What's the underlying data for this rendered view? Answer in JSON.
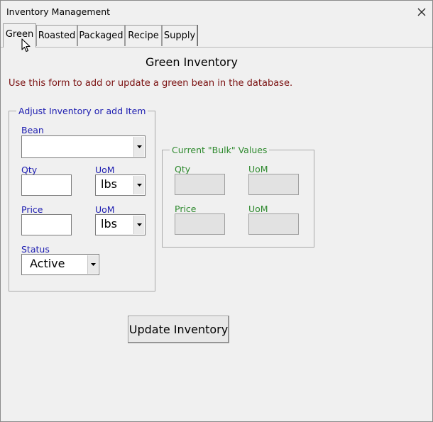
{
  "window": {
    "title": "Inventory Management"
  },
  "tabs": [
    {
      "label": "Green",
      "active": true
    },
    {
      "label": "Roasted",
      "active": false
    },
    {
      "label": "Packaged",
      "active": false
    },
    {
      "label": "Recipe",
      "active": false
    },
    {
      "label": "Supply",
      "active": false
    }
  ],
  "form": {
    "heading": "Green Inventory",
    "instructions": "Use this form to add or update a green bean in the database.",
    "adjust_group": {
      "legend": "Adjust Inventory or add Item",
      "bean_label": "Bean",
      "bean_value": "",
      "qty_label": "Qty",
      "qty_value": "",
      "qty_uom_label": "UoM",
      "qty_uom_value": "lbs",
      "price_label": "Price",
      "price_value": "",
      "price_uom_label": "UoM",
      "price_uom_value": "lbs",
      "status_label": "Status",
      "status_value": "Active"
    },
    "bulk_group": {
      "legend": "Current \"Bulk\" Values",
      "qty_label": "Qty",
      "qty_uom_label": "UoM",
      "price_label": "Price",
      "price_uom_label": "UoM"
    },
    "update_button": "Update Inventory"
  },
  "colors": {
    "instruction_text": "#7a1010",
    "blue_label": "#1c1cb0",
    "green_label": "#2f8a2f"
  },
  "icons": {
    "close": "close-icon",
    "dropdown": "chevron-down-icon",
    "cursor": "mouse-pointer-icon"
  }
}
